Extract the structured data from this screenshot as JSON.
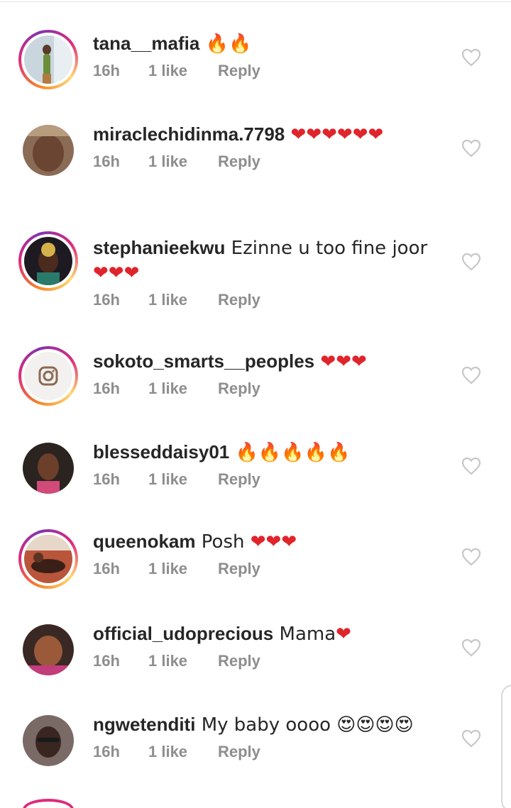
{
  "comments": [
    {
      "username": "tana__mafia",
      "text": " 🔥🔥",
      "time": "16h",
      "likes": "1 like",
      "reply": "Reply",
      "story": true
    },
    {
      "username": "miraclechidinma.7798",
      "text": " ❤❤❤❤❤❤",
      "time": "16h",
      "likes": "1 like",
      "reply": "Reply",
      "story": false
    },
    {
      "username": "stephanieekwu",
      "text": " Ezinne u too fine joor ❤❤❤",
      "time": "16h",
      "likes": "1 like",
      "reply": "Reply",
      "story": true
    },
    {
      "username": "sokoto_smarts__peoples",
      "text": " ❤❤❤",
      "time": "16h",
      "likes": "1 like",
      "reply": "Reply",
      "story": true
    },
    {
      "username": "blesseddaisy01",
      "text": " 🔥🔥🔥🔥🔥",
      "time": "16h",
      "likes": "1 like",
      "reply": "Reply",
      "story": false
    },
    {
      "username": "queenokam",
      "text": " Posh ❤❤❤",
      "time": "16h",
      "likes": "1 like",
      "reply": "Reply",
      "story": true
    },
    {
      "username": "official_udoprecious",
      "text": " Mama❤",
      "time": "16h",
      "likes": "1 like",
      "reply": "Reply",
      "story": false
    },
    {
      "username": "ngwetenditi",
      "text": " My baby oooo 😍😍😍😍",
      "time": "16h",
      "likes": "1 like",
      "reply": "Reply",
      "story": false
    }
  ],
  "icons": {
    "like": "heart-outline-icon"
  },
  "colors": {
    "text": "#262626",
    "meta": "#8e8e8e",
    "heart": "#d4d4d4",
    "ring_start": "#f58529",
    "ring_end": "#dd2a7b"
  }
}
